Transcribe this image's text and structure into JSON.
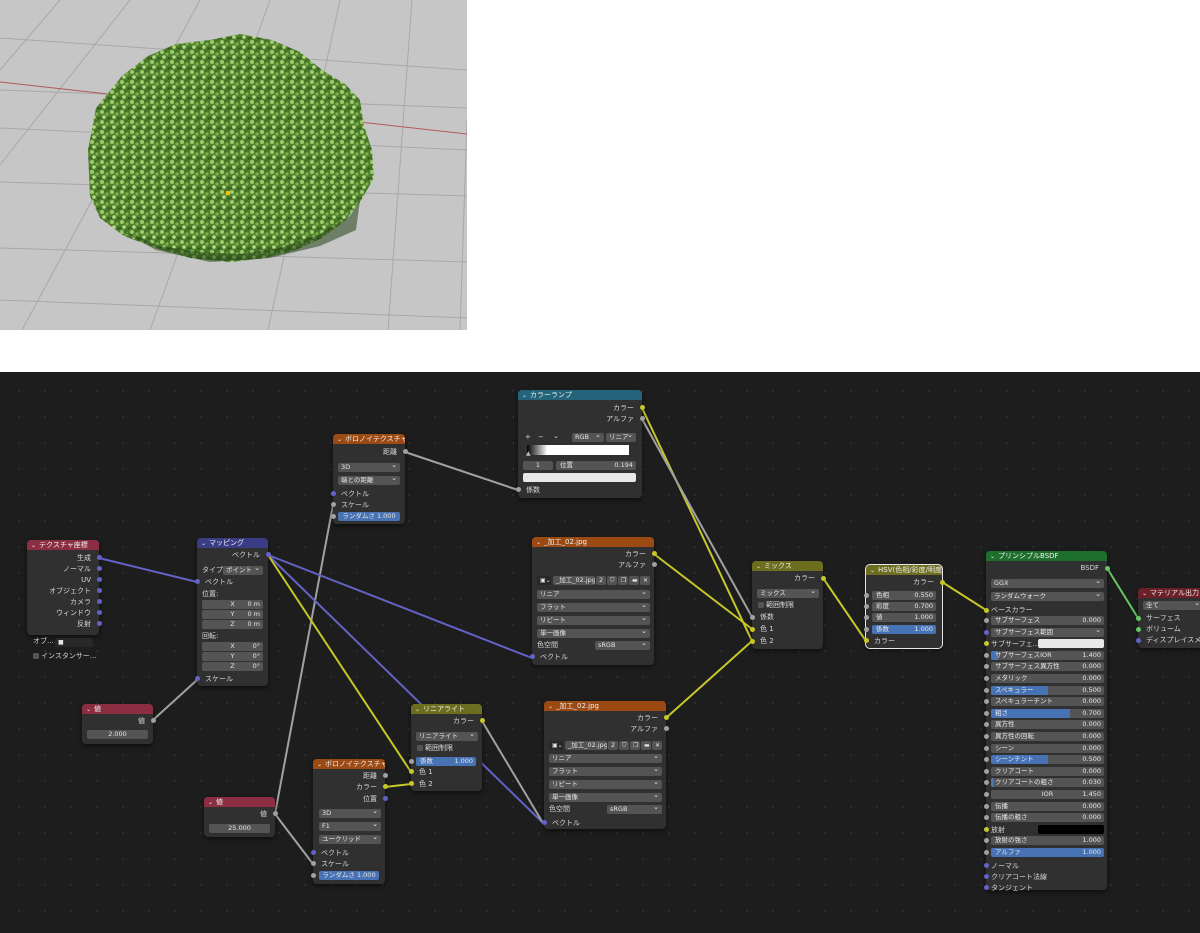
{
  "nodes": {
    "tex_coord": {
      "title": "テクスチャ座標",
      "outputs": [
        "生成",
        "ノーマル",
        "UV",
        "オブジェクト",
        "カメラ",
        "ウィンドウ",
        "反射"
      ],
      "object_label": "オブ...",
      "instancer": "インスタンサー..."
    },
    "mapping": {
      "title": "マッピング",
      "output": "ベクトル",
      "type_label": "タイプ",
      "type_value": "ポイント",
      "vector_input": "ベクトル",
      "location_label": "位置:",
      "location": [
        {
          "axis": "X",
          "value": "0 m"
        },
        {
          "axis": "Y",
          "value": "0 m"
        },
        {
          "axis": "Z",
          "value": "0 m"
        }
      ],
      "rotation_label": "回転:",
      "rotation": [
        {
          "axis": "X",
          "value": "0°"
        },
        {
          "axis": "Y",
          "value": "0°"
        },
        {
          "axis": "Z",
          "value": "0°"
        }
      ],
      "scale_input": "スケール"
    },
    "value1": {
      "title": "値",
      "output": "値",
      "value": "2.000"
    },
    "value2": {
      "title": "値",
      "output": "値",
      "value": "25.000"
    },
    "voronoi1": {
      "title": "ボロノイテクスチャ",
      "output": "距離",
      "dim": "3D",
      "feature": "端との距離",
      "in_vector": "ベクトル",
      "in_scale": "スケール",
      "randomness": "ランダムさ 1.000"
    },
    "voronoi2": {
      "title": "ボロノイテクスチャ",
      "outputs": [
        "距離",
        "カラー",
        "位置"
      ],
      "dim": "3D",
      "feature": "F1",
      "metric": "ユークリッド",
      "in_vector": "ベクトル",
      "in_scale": "スケール",
      "randomness": "ランダムさ 1.000"
    },
    "colorramp": {
      "title": "カラーランプ",
      "outputs": [
        "カラー",
        "アルファ"
      ],
      "plus": "+",
      "minus": "−",
      "chevron": "⌄",
      "mode": "RGB",
      "interp": "リニア",
      "index": "1",
      "pos_label": "位置",
      "pos_value": "0.194",
      "fac": "係数"
    },
    "image1": {
      "title": "_加工_02.jpg",
      "outputs": [
        "カラー",
        "アルファ"
      ],
      "image_name": "_加工_02.jpg",
      "users": "2",
      "interp": "リニア",
      "proj": "フラット",
      "ext": "リピート",
      "source": "単一画像",
      "cs_label": "色空間",
      "cs_value": "sRGB",
      "in_vector": "ベクトル"
    },
    "image2": {
      "title": "_加工_02.jpg",
      "outputs": [
        "カラー",
        "アルファ"
      ],
      "image_name": "_加工_02.jpg",
      "users": "2",
      "interp": "リニア",
      "proj": "フラット",
      "ext": "リピート",
      "source": "単一画像",
      "cs_label": "色空間",
      "cs_value": "sRGB",
      "in_vector": "ベクトル"
    },
    "linearlight": {
      "title": "リニアライト",
      "output": "カラー",
      "mode": "リニアライト",
      "clamp": "範囲制限",
      "fac_label": "係数",
      "fac_value": "1.000",
      "in1": "色 1",
      "in2": "色 2"
    },
    "mix": {
      "title": "ミックス",
      "output": "カラー",
      "mode": "ミックス",
      "clamp": "範囲制限",
      "fac": "係数",
      "in1": "色 1",
      "in2": "色 2"
    },
    "hsv": {
      "title": "HSV(色相/彩度/明度)",
      "output": "カラー",
      "params": [
        {
          "label": "色相",
          "value": "0.550"
        },
        {
          "label": "彩度",
          "value": "0.700"
        },
        {
          "label": "値",
          "value": "1.000"
        },
        {
          "label": "係数",
          "value": "1.000"
        }
      ],
      "in_color": "カラー"
    },
    "bsdf": {
      "title": "プリンシプルBSDF",
      "output": "BSDF",
      "dist": "GGX",
      "ss_method": "ランダムウォーク",
      "base_color": "ベースカラー",
      "sliders": [
        {
          "label": "サブサーフェス",
          "value": "0.000",
          "fill": 0
        },
        {
          "label": "サブサーフェス範囲",
          "value": "",
          "fill": 0,
          "dropdown": true
        },
        {
          "label": "サブサーフェ...",
          "value": "",
          "fill": 0,
          "swatch": "#e8e8e8"
        },
        {
          "label": "サブサーフェスIOR",
          "value": "1.400",
          "fill": 0.06
        },
        {
          "label": "サブサーフェス異方性",
          "value": "0.000",
          "fill": 0
        },
        {
          "label": "メタリック",
          "value": "0.000",
          "fill": 0
        },
        {
          "label": "スペキュラー",
          "value": "0.500",
          "fill": 0.5
        },
        {
          "label": "スペキュラーチント",
          "value": "0.000",
          "fill": 0
        },
        {
          "label": "粗さ",
          "value": "0.700",
          "fill": 0.7
        },
        {
          "label": "異方性",
          "value": "0.000",
          "fill": 0
        },
        {
          "label": "異方性の回転",
          "value": "0.000",
          "fill": 0
        },
        {
          "label": "シーン",
          "value": "0.000",
          "fill": 0
        },
        {
          "label": "シーンチント",
          "value": "0.500",
          "fill": 0.5
        },
        {
          "label": "クリアコート",
          "value": "0.000",
          "fill": 0
        },
        {
          "label": "クリアコートの粗さ",
          "value": "0.030",
          "fill": 0.03
        },
        {
          "label": "IOR",
          "value": "1.450",
          "fill": 0,
          "center": true
        },
        {
          "label": "伝播",
          "value": "0.000",
          "fill": 0
        },
        {
          "label": "伝播の粗さ",
          "value": "0.000",
          "fill": 0
        },
        {
          "label": "放射",
          "value": "",
          "fill": 0,
          "swatch": "#000000"
        },
        {
          "label": "放射の強さ",
          "value": "1.000",
          "fill": 0
        },
        {
          "label": "アルファ",
          "value": "1.000",
          "fill": 1
        }
      ],
      "tail_inputs": [
        "ノーマル",
        "クリアコート法線",
        "タンジェント"
      ]
    },
    "matout": {
      "title": "マテリアル出力",
      "target": "全て",
      "inputs": [
        "サーフェス",
        "ボリューム",
        "ディスプレイスメン"
      ]
    }
  }
}
